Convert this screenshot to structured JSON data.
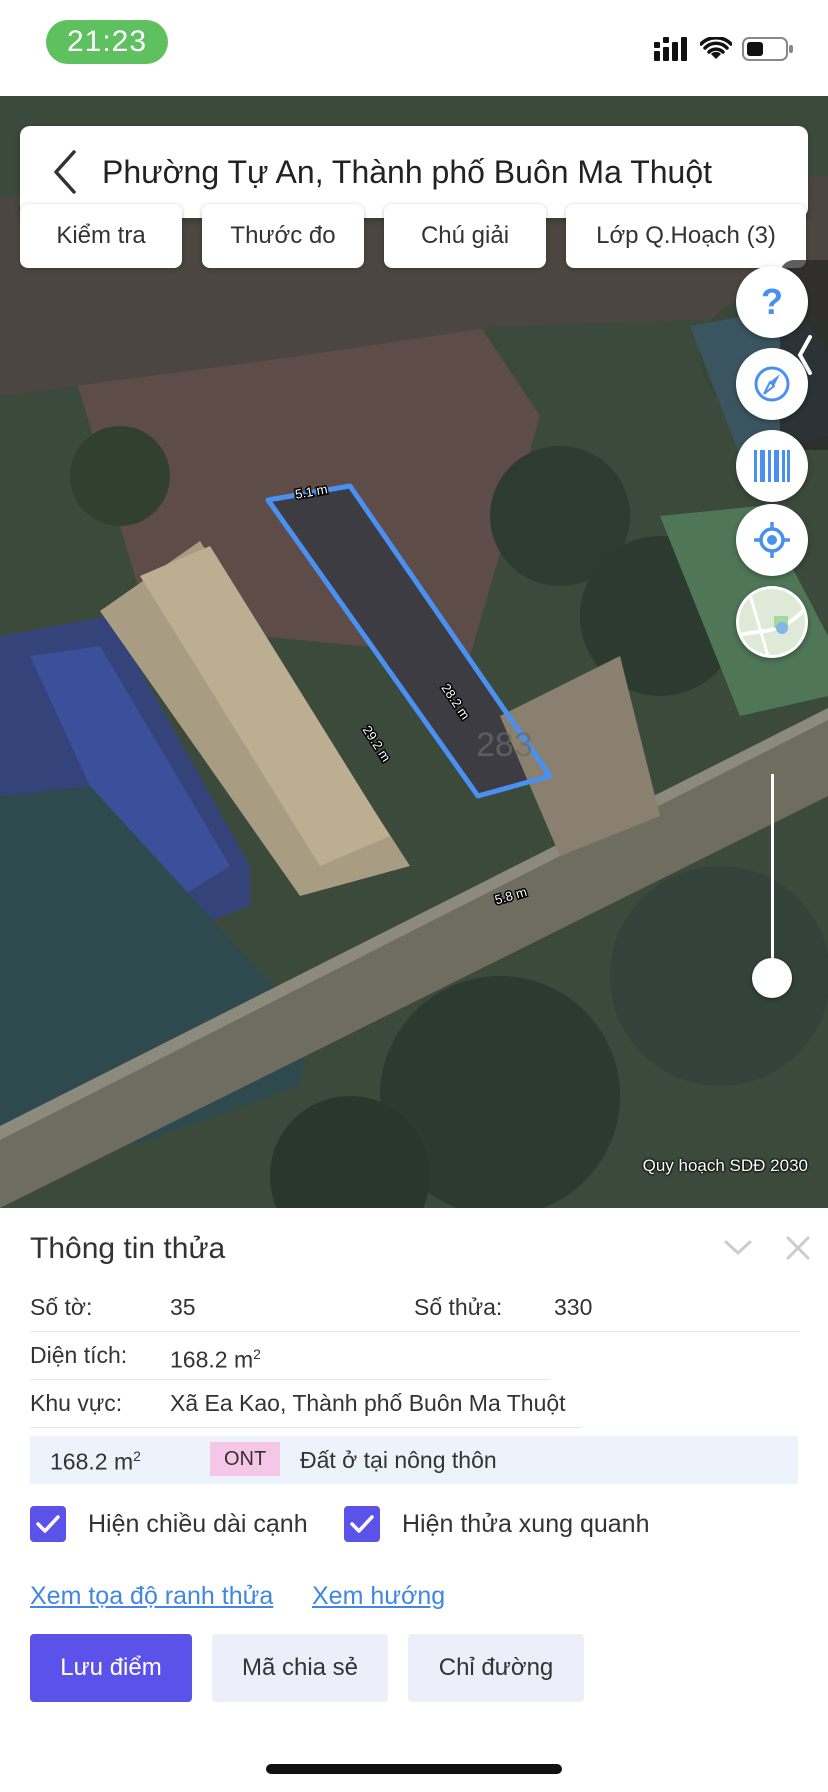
{
  "status_bar": {
    "time": "21:23"
  },
  "map": {
    "search_title": "Phường Tự An, Thành phố Buôn Ma Thuột",
    "tools": [
      "Kiểm tra",
      "Thước đo",
      "Chú giải",
      "Lớp Q.Hoạch (3)"
    ],
    "edge_labels": [
      "5.1 m",
      "28.2 m",
      "29.2 m",
      "5.8 m"
    ],
    "parcel_label": "283",
    "caption": "Quy hoạch SDĐ 2030",
    "parcel_color": "#4a90f0"
  },
  "panel": {
    "title": "Thông tin thửa",
    "sheet_label": "Số tờ:",
    "sheet_value": "35",
    "parcel_label": "Số thửa:",
    "parcel_value": "330",
    "area_label": "Diện tích:",
    "area_value": "168.2 m",
    "area_unit_sup": "2",
    "region_label": "Khu vực:",
    "region_value": "Xã Ea Kao, Thành phố Buôn Ma Thuột",
    "landuse": {
      "area": "168.2 m",
      "area_sup": "2",
      "code": "ONT",
      "description": "Đất ở tại nông thôn"
    },
    "checkbox_edge_length": "Hiện chiều dài cạnh",
    "checkbox_neighbors": "Hiện thửa xung quanh",
    "link_coordinates": "Xem tọa độ ranh thửa",
    "link_direction": "Xem hướng",
    "button_save": "Lưu điểm",
    "button_share": "Mã chia sẻ",
    "button_directions": "Chỉ đường",
    "accent_color": "#5b52ea",
    "link_color": "#3f86e6"
  }
}
